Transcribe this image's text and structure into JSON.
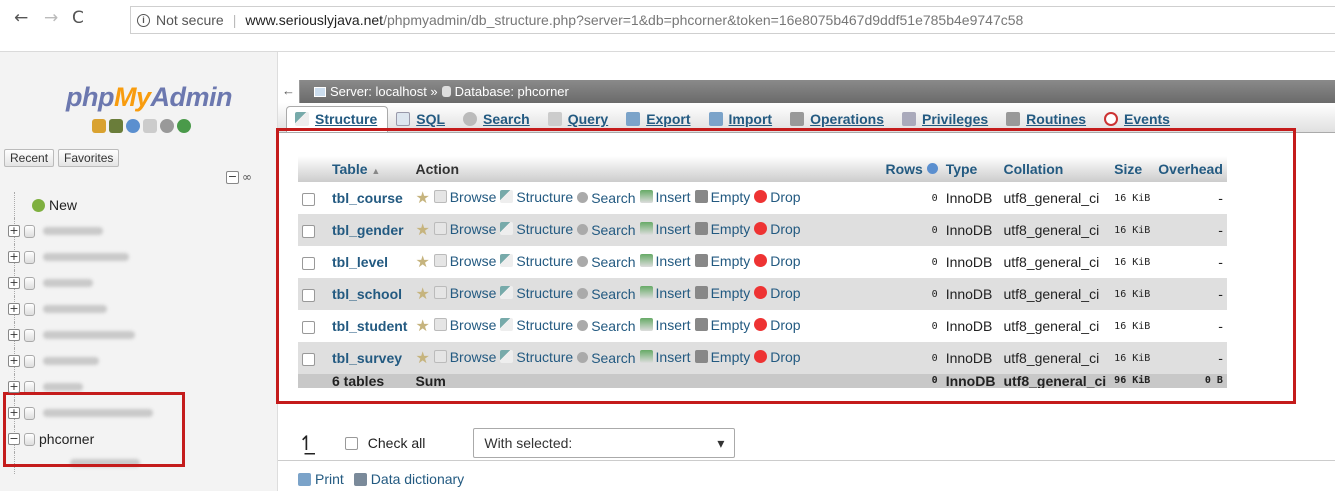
{
  "browser": {
    "secure_label": "Not secure",
    "url_host": "www.seriouslyjava.net",
    "url_path": "/phpmyadmin/db_structure.php?server=1&db=phcorner&token=16e8075b467d9ddf51e785b4e9747c58"
  },
  "nav": {
    "logo_php": "php",
    "logo_my": "My",
    "logo_admin": "Admin",
    "recent_label": "Recent",
    "favorites_label": "Favorites",
    "new_label": "New",
    "current_db": "phcorner"
  },
  "breadcrumb": {
    "server": "Server: localhost »",
    "database": "Database: phcorner"
  },
  "topmenu": [
    "Structure",
    "SQL",
    "Search",
    "Query",
    "Export",
    "Import",
    "Operations",
    "Privileges",
    "Routines",
    "Events"
  ],
  "table": {
    "headers": {
      "table": "Table",
      "action": "Action",
      "rows": "Rows",
      "type": "Type",
      "collation": "Collation",
      "size": "Size",
      "overhead": "Overhead"
    },
    "actions": {
      "browse": "Browse",
      "structure": "Structure",
      "search": "Search",
      "insert": "Insert",
      "empty": "Empty",
      "drop": "Drop"
    },
    "rows": [
      {
        "name": "tbl_course",
        "rows": "0",
        "type": "InnoDB",
        "collation": "utf8_general_ci",
        "size": "16 KiB",
        "overhead": "-"
      },
      {
        "name": "tbl_gender",
        "rows": "0",
        "type": "InnoDB",
        "collation": "utf8_general_ci",
        "size": "16 KiB",
        "overhead": "-"
      },
      {
        "name": "tbl_level",
        "rows": "0",
        "type": "InnoDB",
        "collation": "utf8_general_ci",
        "size": "16 KiB",
        "overhead": "-"
      },
      {
        "name": "tbl_school",
        "rows": "0",
        "type": "InnoDB",
        "collation": "utf8_general_ci",
        "size": "16 KiB",
        "overhead": "-"
      },
      {
        "name": "tbl_student",
        "rows": "0",
        "type": "InnoDB",
        "collation": "utf8_general_ci",
        "size": "16 KiB",
        "overhead": "-"
      },
      {
        "name": "tbl_survey",
        "rows": "0",
        "type": "InnoDB",
        "collation": "utf8_general_ci",
        "size": "16 KiB",
        "overhead": "-"
      }
    ],
    "footer": {
      "count": "6 tables",
      "sum": "Sum",
      "rows": "0",
      "type": "InnoDB",
      "collation": "utf8_general_ci",
      "size": "96 KiB",
      "overhead": "0 B"
    }
  },
  "bulk": {
    "check_all": "Check all",
    "with_selected": "With selected:"
  },
  "footer_links": {
    "print": "Print",
    "data_dictionary": "Data dictionary"
  },
  "colors": {
    "link": "#235a81",
    "annotation_red": "#c41b1b",
    "logo_blue": "#6c78af",
    "logo_orange": "#f89c0e"
  }
}
